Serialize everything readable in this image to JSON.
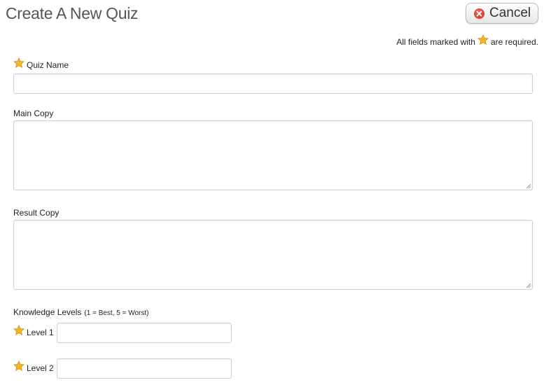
{
  "header": {
    "title": "Create A New Quiz",
    "cancel_label": "Cancel"
  },
  "required_note": {
    "prefix": "All fields marked with",
    "suffix": "are required."
  },
  "fields": {
    "quiz_name": {
      "label": "Quiz Name",
      "value": "",
      "required": true
    },
    "main_copy": {
      "label": "Main Copy",
      "value": "",
      "required": false
    },
    "result_copy": {
      "label": "Result Copy",
      "value": "",
      "required": false
    }
  },
  "knowledge_levels": {
    "label": "Knowledge Levels",
    "hint": "(1 = Best, 5 = Worst)",
    "levels": [
      {
        "label": "Level 1",
        "value": "",
        "required": true
      },
      {
        "label": "Level 2",
        "value": "",
        "required": true
      }
    ]
  },
  "colors": {
    "star": "#f3b52c",
    "cancel_icon": "#d93a2b",
    "title": "#555555"
  },
  "icons": {
    "required": "star-icon",
    "cancel": "close-circle-icon"
  }
}
